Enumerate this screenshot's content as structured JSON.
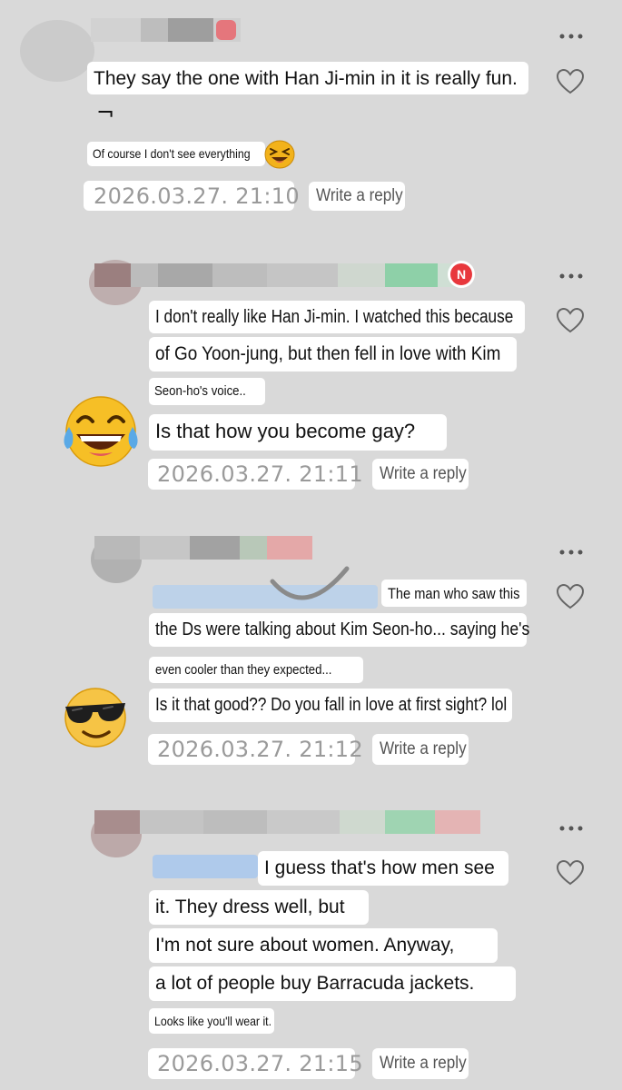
{
  "comments": [
    {
      "lines": [
        "They say the one with Han Ji-min in it is really fun.",
        "¬"
      ],
      "small_line": "Of course I don't see everything",
      "timestamp": "2026.03.27. 21:10",
      "reply_label": "Write a reply",
      "emoji": "squint-laugh-emoji"
    },
    {
      "lines": [
        "I don't really like Han Ji-min. I watched this because",
        "of Go Yoon-jung, but then fell in love with Kim",
        "Seon-ho's voice..",
        "Is that how you become gay?"
      ],
      "timestamp": "2026.03.27. 21:11",
      "reply_label": "Write a reply",
      "badge": "N",
      "emoji": "tears-of-joy-emoji"
    },
    {
      "lines": [
        "The man who saw this",
        "the Ds were talking about Kim Seon-ho... saying he's",
        "even cooler than they expected...",
        "Is it that good?? Do you fall in love at first sight? lol"
      ],
      "timestamp": "2026.03.27. 21:12",
      "reply_label": "Write a reply",
      "emoji": "sunglasses-emoji"
    },
    {
      "lines": [
        "I guess that's how men see",
        "it. They dress well, but",
        "I'm not sure about women. Anyway,",
        "a lot of people buy Barracuda jackets.",
        "Looks like you'll wear it."
      ],
      "timestamp": "2026.03.27. 21:15",
      "reply_label": "Write a reply"
    }
  ],
  "colors": {
    "background": "#d9d9d9",
    "bubble": "#ffffff",
    "timestamp": "#9a9a9a",
    "badge": "#e8383d"
  }
}
